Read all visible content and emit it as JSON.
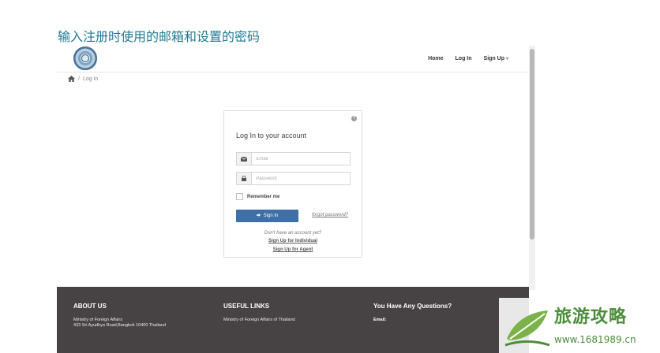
{
  "caption": "输入注册时使用的邮箱和设置的密码",
  "nav": {
    "items": [
      {
        "label": "Home"
      },
      {
        "label": "Log In"
      },
      {
        "label": "Sign Up"
      }
    ]
  },
  "breadcrumb": {
    "current": "Log In"
  },
  "login": {
    "title": "Log In to your account",
    "email_placeholder": "Email",
    "password_placeholder": "Password",
    "remember_label": "Remember me",
    "signin_label": "Sign In",
    "forgot_label": "forgot password?",
    "no_account": "Don't have an account yet?",
    "signup_individual": "Sign Up for Individual",
    "signup_agent": "Sign Up for Agent"
  },
  "footer": {
    "about": {
      "heading": "ABOUT US",
      "line1": "Ministry of Foreign Affairs",
      "line2": "433 Sri Ayudhya Road,Bangkok 10400 Thailand"
    },
    "links": {
      "heading": "USEFUL LINKS",
      "line1": "Ministry of Foreign Affairs of Thailand"
    },
    "questions": {
      "heading": "You Have Any Questions?",
      "email_label": "Email:"
    }
  },
  "watermark": {
    "title": "旅游攻略",
    "url": "www.1681989.cn"
  },
  "colors": {
    "caption": "#1f7a94",
    "primary_button": "#3f6fa7",
    "footer_bg": "#474344",
    "watermark": "#4a8e3a"
  },
  "icons": {
    "home": "home-icon",
    "email": "envelope-icon",
    "password": "lock-icon",
    "help": "question-circle-icon",
    "signin": "sign-in-icon",
    "dropdown": "caret-down-icon"
  }
}
